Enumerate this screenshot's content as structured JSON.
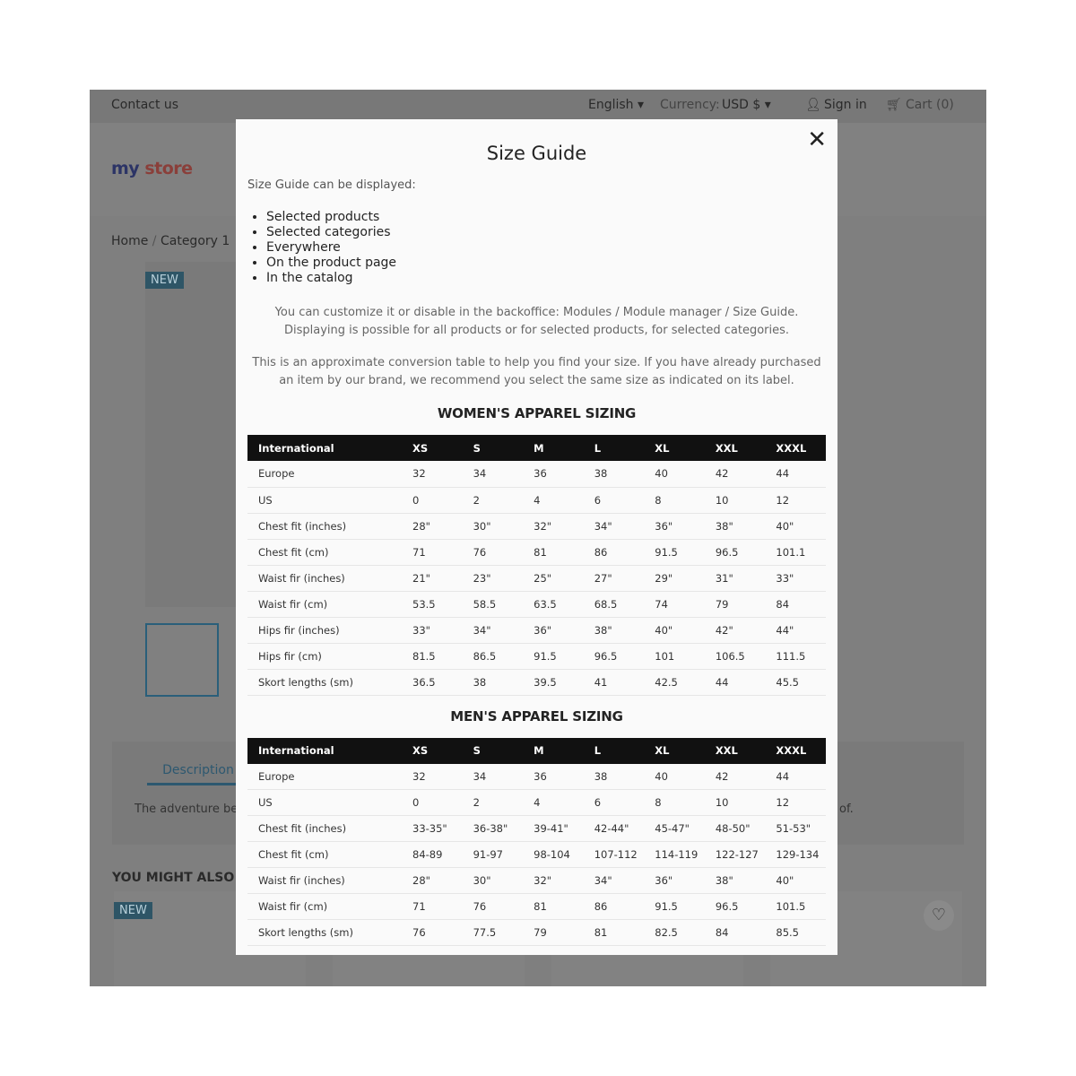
{
  "topbar": {
    "contact": "Contact us",
    "language": "English ▾",
    "currency_label": "Currency:",
    "currency": "USD $ ▾",
    "signin": "Sign in",
    "cart": "Cart (0)"
  },
  "logo": "my store",
  "breadcrumb": [
    "Home",
    "/",
    "Category 1"
  ],
  "badges": {
    "new": "NEW"
  },
  "tabs": {
    "description": "Description",
    "description_text": "The adventure be",
    "desc_tail": "of."
  },
  "related_title": "YOU MIGHT ALSO LI",
  "modal": {
    "title": "Size Guide",
    "intro": "Size Guide can be displayed:",
    "list": [
      "Selected products",
      "Selected categories",
      "Everywhere",
      "On the product page",
      "In the catalog"
    ],
    "para1": "You can customize it or disable in the backoffice: Modules / Module manager / Size Guide. Displaying is possible for all products or for selected products, for selected categories.",
    "para2": "This is an approximate conversion table to help you find your size. If you have already purchased an item by our brand, we recommend you select the same size as indicated on its label.",
    "women": {
      "title": "WOMEN'S APPAREL SIZING",
      "headers": [
        "International",
        "XS",
        "S",
        "M",
        "L",
        "XL",
        "XXL",
        "XXXL"
      ],
      "rows": [
        [
          "Europe",
          "32",
          "34",
          "36",
          "38",
          "40",
          "42",
          "44"
        ],
        [
          "US",
          "0",
          "2",
          "4",
          "6",
          "8",
          "10",
          "12"
        ],
        [
          "Chest fit (inches)",
          "28\"",
          "30\"",
          "32\"",
          "34\"",
          "36\"",
          "38\"",
          "40\""
        ],
        [
          "Chest fit (cm)",
          "71",
          "76",
          "81",
          "86",
          "91.5",
          "96.5",
          "101.1"
        ],
        [
          "Waist fir (inches)",
          "21\"",
          "23\"",
          "25\"",
          "27\"",
          "29\"",
          "31\"",
          "33\""
        ],
        [
          "Waist fir (cm)",
          "53.5",
          "58.5",
          "63.5",
          "68.5",
          "74",
          "79",
          "84"
        ],
        [
          "Hips fir (inches)",
          "33\"",
          "34\"",
          "36\"",
          "38\"",
          "40\"",
          "42\"",
          "44\""
        ],
        [
          "Hips fir (cm)",
          "81.5",
          "86.5",
          "91.5",
          "96.5",
          "101",
          "106.5",
          "111.5"
        ],
        [
          "Skort lengths (sm)",
          "36.5",
          "38",
          "39.5",
          "41",
          "42.5",
          "44",
          "45.5"
        ]
      ]
    },
    "men": {
      "title": "MEN'S APPAREL SIZING",
      "headers": [
        "International",
        "XS",
        "S",
        "M",
        "L",
        "XL",
        "XXL",
        "XXXL"
      ],
      "rows": [
        [
          "Europe",
          "32",
          "34",
          "36",
          "38",
          "40",
          "42",
          "44"
        ],
        [
          "US",
          "0",
          "2",
          "4",
          "6",
          "8",
          "10",
          "12"
        ],
        [
          "Chest fit (inches)",
          "33-35\"",
          "36-38\"",
          "39-41\"",
          "42-44\"",
          "45-47\"",
          "48-50\"",
          "51-53\""
        ],
        [
          "Chest fit (cm)",
          "84-89",
          "91-97",
          "98-104",
          "107-112",
          "114-119",
          "122-127",
          "129-134"
        ],
        [
          "Waist fir (inches)",
          "28\"",
          "30\"",
          "32\"",
          "34\"",
          "36\"",
          "38\"",
          "40\""
        ],
        [
          "Waist fir (cm)",
          "71",
          "76",
          "81",
          "86",
          "91.5",
          "96.5",
          "101.5"
        ],
        [
          "Skort lengths (sm)",
          "76",
          "77.5",
          "79",
          "81",
          "82.5",
          "84",
          "85.5"
        ]
      ]
    }
  }
}
